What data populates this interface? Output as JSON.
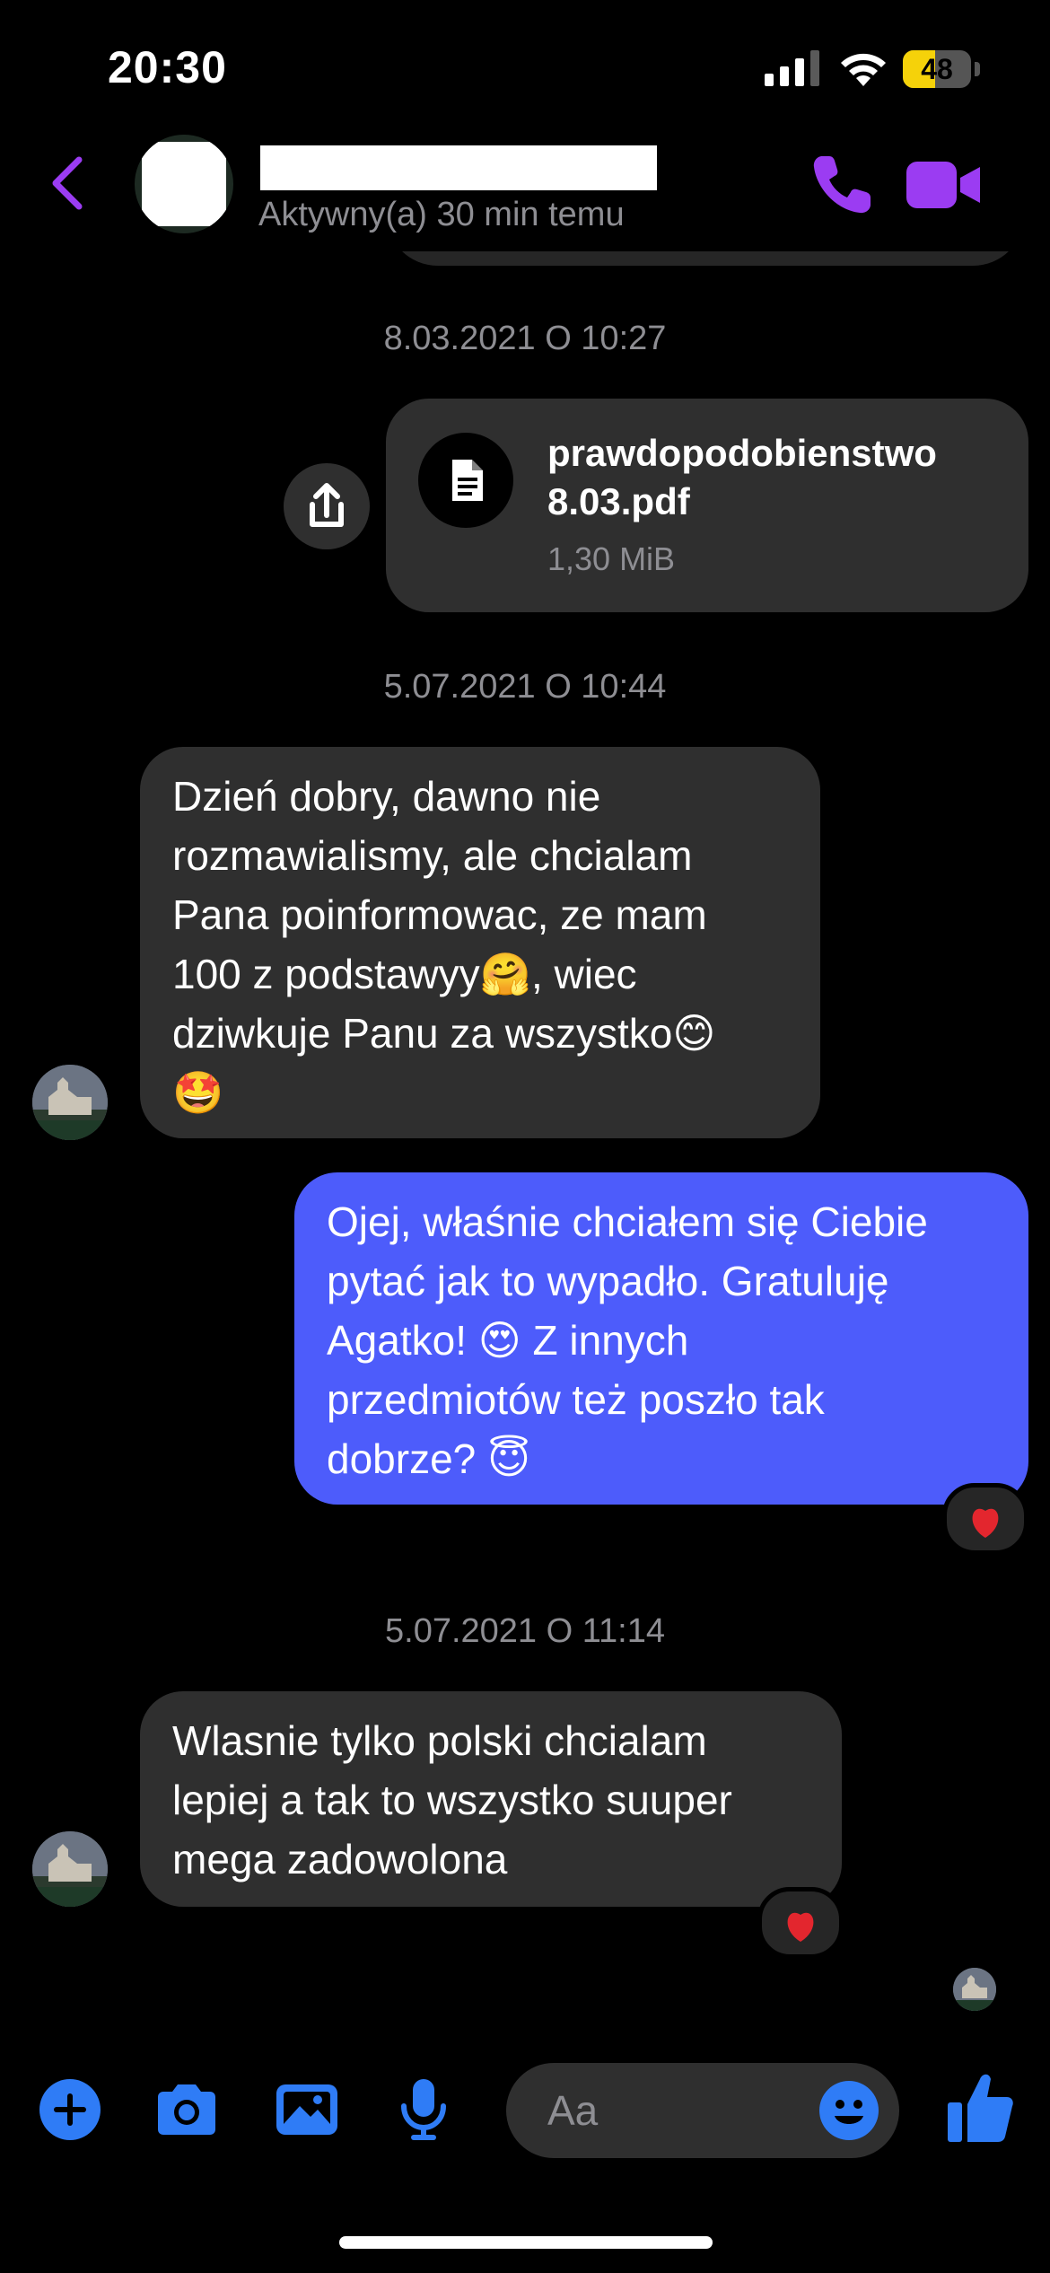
{
  "status_bar": {
    "time": "20:30",
    "battery": "48",
    "battery_level": 0.48
  },
  "header": {
    "contact_status": "Aktywny(a) 30 min temu",
    "back_icon": "chevron-left-icon",
    "call_icon": "phone-icon",
    "video_icon": "video-camera-icon"
  },
  "messages": {
    "timestamp_1": "8.03.2021 O 10:27",
    "file": {
      "name": "prawdopodobienstwo\n8.03.pdf",
      "size": "1,30 MiB",
      "icon": "document-icon"
    },
    "timestamp_2": "5.07.2021 O 10:44",
    "incoming_1": {
      "line1": "Dzień dobry, dawno nie\nrozmawialismy, ale chcialam\nPana poinformowac, ze mam\n100 z podstawyy",
      "emoji1": "🤗",
      "line2": ", wiec\ndziwkuje Panu za wszystko",
      "emoji2": "😊",
      "emoji3": "🤩"
    },
    "outgoing_1": {
      "part1": "Ojej, właśnie chciałem się Ciebie\npytać jak to wypadło. Gratuluję\nAgatko! ",
      "emoji1": "😍",
      "part2": " Z innych\nprzedmiotów też poszło tak\ndobrze? ",
      "emoji2": "😇",
      "reaction": "❤️"
    },
    "timestamp_3": "5.07.2021 O 11:14",
    "incoming_2": {
      "text": "Wlasnie tylko polski chcialam\nlepiej a tak to wszystko suuper\nmega zadowolona",
      "reaction": "❤️"
    }
  },
  "composer": {
    "placeholder": "Aa",
    "icons": [
      "plus-icon",
      "camera-icon",
      "image-icon",
      "microphone-icon",
      "emoji-icon",
      "thumbs-up-icon"
    ]
  },
  "colors": {
    "accent_purple": "#9b3cf2",
    "accent_blue": "#2f7cf6",
    "bubble_outgoing": "#4d5cfb",
    "bubble_incoming": "#2f2f2f",
    "battery_yellow": "#f5d20a"
  }
}
